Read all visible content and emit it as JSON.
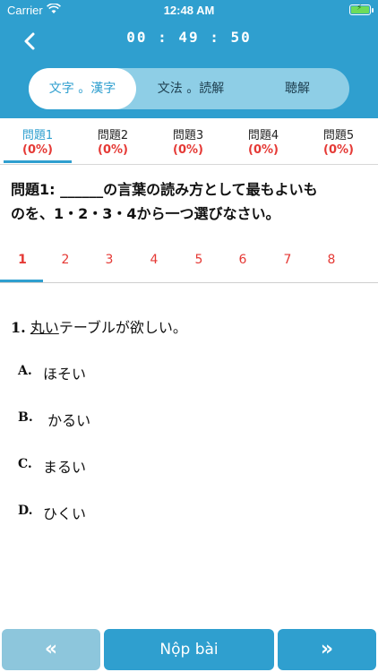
{
  "status_bar": {
    "carrier": "Carrier",
    "time": "12:48 AM",
    "icons": [
      "wifi-icon",
      "battery-charging-icon"
    ]
  },
  "header": {
    "back_icon": "chevron-left-icon",
    "timer": "00 : 49 : 50",
    "segments": [
      {
        "label": "文字 。漢字",
        "active": true
      },
      {
        "label": "文法 。読解",
        "active": false
      },
      {
        "label": "聴解",
        "active": false
      }
    ]
  },
  "section_tabs": [
    {
      "label": "問題1",
      "percent": "(0%)",
      "active": true
    },
    {
      "label": "問題2",
      "percent": "(0%)",
      "active": false
    },
    {
      "label": "問題3",
      "percent": "(0%)",
      "active": false
    },
    {
      "label": "問題4",
      "percent": "(0%)",
      "active": false
    },
    {
      "label": "問題5",
      "percent": "(0%)",
      "active": false
    }
  ],
  "instruction": {
    "line1": "問題1: ______の言葉の読み方として最もよいも",
    "line2": "のを、1・2・3・4から一つ選びなさい。"
  },
  "question_numbers": [
    "1",
    "2",
    "3",
    "4",
    "5",
    "6",
    "7",
    "8"
  ],
  "question": {
    "number": "1.",
    "underlined": "丸い",
    "rest": "テーブルが欲しい。",
    "options": [
      {
        "letter": "A.",
        "text": "ほそい"
      },
      {
        "letter": "B.",
        "text": " かるい"
      },
      {
        "letter": "C.",
        "text": "まるい"
      },
      {
        "letter": "D.",
        "text": "ひくい"
      }
    ]
  },
  "footer": {
    "prev_icon": "double-chevron-left-icon",
    "prev_label": "«",
    "submit_label": "Nộp bài",
    "next_icon": "double-chevron-right-icon",
    "next_label": "»"
  },
  "colors": {
    "primary": "#2f9fcf",
    "segment_bg": "#8ecee6",
    "accent_red": "#e53935",
    "prev_button": "#8dc6dc"
  }
}
